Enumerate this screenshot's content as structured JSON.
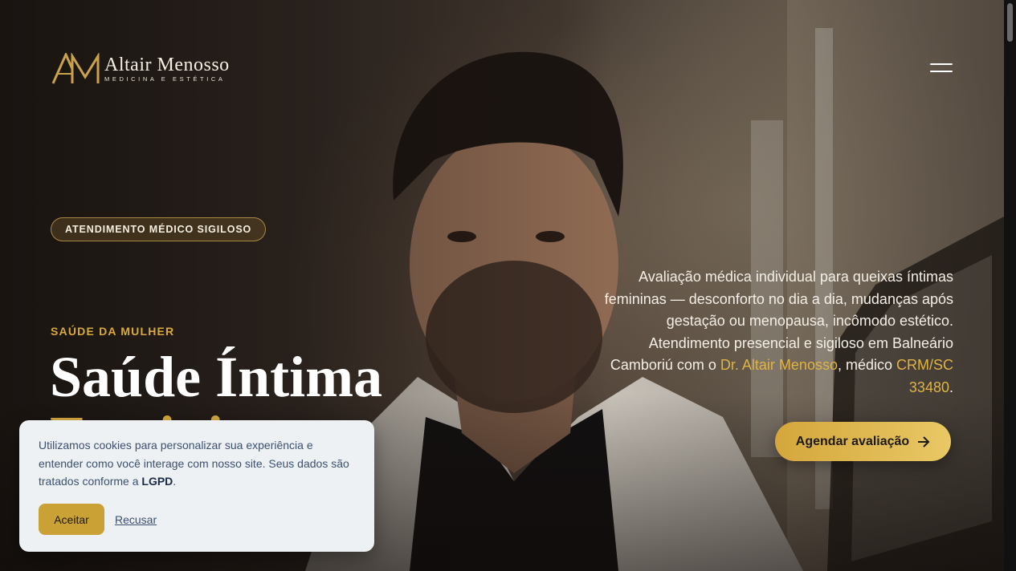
{
  "header": {
    "logo_name": "Altair Menosso",
    "logo_tagline": "MEDICINA E ESTÉTICA",
    "menu_icon": "hamburger-menu-icon"
  },
  "hero": {
    "pill": "ATENDIMENTO MÉDICO SIGILOSO",
    "kicker": "SAÚDE DA MULHER",
    "headline": "Saúde Íntima",
    "headline_accent": "Feminina",
    "description_part1": "Avaliação médica individual para queixas íntimas femininas — desconforto no dia a dia, mudanças após gestação ou menopausa, incômodo estético. Atendimento presencial e sigiloso em Balneário Camboriú com o ",
    "description_doctor": "Dr. Altair Menosso",
    "description_part2": ", médico ",
    "description_crm": "CRM/SC 33480",
    "description_part3": ".",
    "cta_label": "Agendar avaliação",
    "cta_icon": "arrow-right-icon"
  },
  "cookie_banner": {
    "text": "Utilizamos cookies para personalizar sua experiência e entender como você interage com nosso site. Seus dados são tratados conforme a ",
    "text_strong": "LGPD",
    "text_end": ".",
    "accept_label": "Aceitar",
    "decline_label": "Recusar"
  },
  "colors": {
    "gold": "#d6a842",
    "cta_gold": "#e0b345",
    "cookie_bg": "#eef1f4",
    "cookie_text": "#3b5070"
  }
}
